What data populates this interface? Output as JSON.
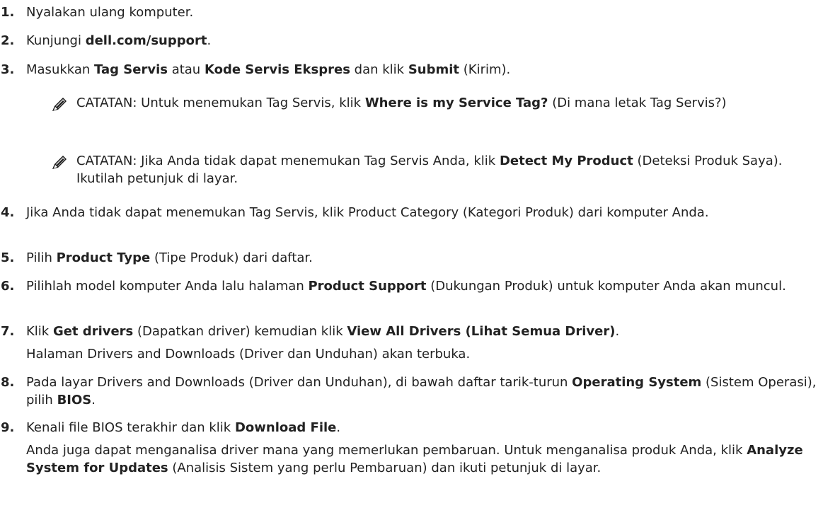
{
  "steps": [
    {
      "num": "1.",
      "runs": [
        {
          "t": "Nyalakan ulang komputer."
        }
      ]
    },
    {
      "num": "2.",
      "runs": [
        {
          "t": "Kunjungi "
        },
        {
          "t": "dell.com/support",
          "b": true
        },
        {
          "t": "."
        }
      ]
    },
    {
      "num": "3.",
      "runs": [
        {
          "t": "Masukkan "
        },
        {
          "t": "Tag Servis",
          "b": true
        },
        {
          "t": " atau "
        },
        {
          "t": "Kode Servis Ekspres",
          "b": true
        },
        {
          "t": " dan klik "
        },
        {
          "t": "Submit",
          "b": true
        },
        {
          "t": " (Kirim)."
        }
      ]
    },
    {
      "num": "4.",
      "runs": [
        {
          "t": "Jika Anda tidak dapat menemukan Tag Servis, klik Product Category (Kategori Produk) dari komputer Anda."
        }
      ]
    },
    {
      "num": "5.",
      "runs": [
        {
          "t": "Pilih "
        },
        {
          "t": "Product Type",
          "b": true
        },
        {
          "t": " (Tipe Produk) dari daftar."
        }
      ]
    },
    {
      "num": "6.",
      "runs": [
        {
          "t": "Pilihlah model komputer Anda lalu halaman "
        },
        {
          "t": "Product Support",
          "b": true
        },
        {
          "t": " (Dukungan Produk) untuk komputer Anda akan muncul."
        }
      ]
    },
    {
      "num": "7.",
      "runs": [
        {
          "t": "Klik "
        },
        {
          "t": "Get drivers",
          "b": true
        },
        {
          "t": " (Dapatkan driver) kemudian klik "
        },
        {
          "t": "View All Drivers (Lihat Semua Driver)",
          "b": true
        },
        {
          "t": "."
        }
      ],
      "extra": [
        {
          "t": "Halaman Drivers and Downloads (Driver dan Unduhan) akan terbuka."
        }
      ]
    },
    {
      "num": "8.",
      "runs": [
        {
          "t": "Pada layar Drivers and Downloads (Driver dan Unduhan), di bawah daftar tarik-turun "
        },
        {
          "t": "Operating System",
          "b": true
        },
        {
          "t": " (Sistem Operasi), pilih "
        },
        {
          "t": "BIOS",
          "b": true
        },
        {
          "t": "."
        }
      ]
    },
    {
      "num": "9.",
      "runs": [
        {
          "t": "Kenali file BIOS terakhir dan klik "
        },
        {
          "t": "Download File",
          "b": true
        },
        {
          "t": "."
        }
      ],
      "extra": [
        {
          "t": "Anda juga dapat menganalisa driver mana yang memerlukan pembaruan. Untuk menganalisa produk Anda, klik "
        },
        {
          "t": "Analyze System for Updates",
          "b": true
        },
        {
          "t": " (Analisis Sistem yang perlu Pembaruan) dan ikuti petunjuk di layar."
        }
      ]
    }
  ],
  "notes": [
    {
      "label": "CATATAN:",
      "runs": [
        {
          "t": " Untuk menemukan Tag Servis, klik "
        },
        {
          "t": "Where is my Service Tag?",
          "b": true
        },
        {
          "t": " (Di mana letak Tag Servis?)"
        }
      ]
    },
    {
      "label": "CATATAN:",
      "runs": [
        {
          "t": " Jika Anda tidak dapat menemukan Tag Servis Anda, klik "
        },
        {
          "t": "Detect My Product",
          "b": true
        },
        {
          "t": " (Deteksi Produk Saya). Ikutilah petunjuk di layar."
        }
      ]
    }
  ],
  "icons": {
    "note": "pencil-note-icon"
  }
}
